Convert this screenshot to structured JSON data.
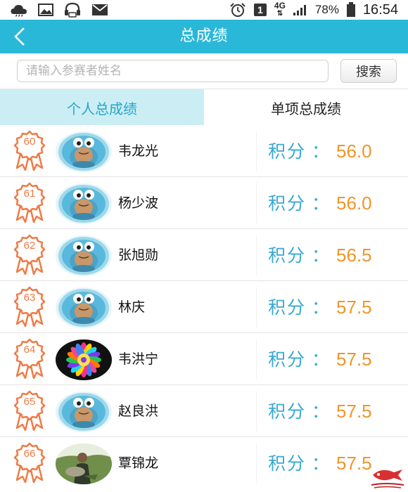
{
  "status_bar": {
    "battery_percent": "78%",
    "time": "16:54",
    "network_type": "4G",
    "sim_slot": "1",
    "icons": [
      "cloud-weather-icon",
      "image-icon",
      "headset-icon",
      "mail-icon",
      "alarm-icon",
      "sim-icon",
      "signal-icon",
      "battery-icon"
    ]
  },
  "header": {
    "title": "总成绩"
  },
  "search": {
    "placeholder": "请输入参赛者姓名",
    "button_label": "搜索"
  },
  "tabs": [
    {
      "label": "个人总成绩",
      "active": true
    },
    {
      "label": "单项总成绩",
      "active": false
    }
  ],
  "colors": {
    "accent": "#2ab8d8",
    "active_tab_bg": "#cbeef4",
    "score_label": "#38a9d2",
    "score_value": "#f0962a",
    "rank_badge": "#f07a44"
  },
  "score_label": "积分",
  "score_colon": "：",
  "rows": [
    {
      "rank": "60",
      "name": "韦龙光",
      "score": "56.0",
      "avatar": "frog-avatar"
    },
    {
      "rank": "61",
      "name": "杨少波",
      "score": "56.0",
      "avatar": "frog-avatar"
    },
    {
      "rank": "62",
      "name": "张旭勋",
      "score": "56.5",
      "avatar": "frog-avatar"
    },
    {
      "rank": "63",
      "name": "林庆",
      "score": "57.5",
      "avatar": "frog-avatar"
    },
    {
      "rank": "64",
      "name": "韦洪宁",
      "score": "57.5",
      "avatar": "mandala-avatar"
    },
    {
      "rank": "65",
      "name": "赵良洪",
      "score": "57.5",
      "avatar": "frog-avatar"
    },
    {
      "rank": "66",
      "name": "覃锦龙",
      "score": "57.5",
      "avatar": "photo-avatar"
    }
  ]
}
